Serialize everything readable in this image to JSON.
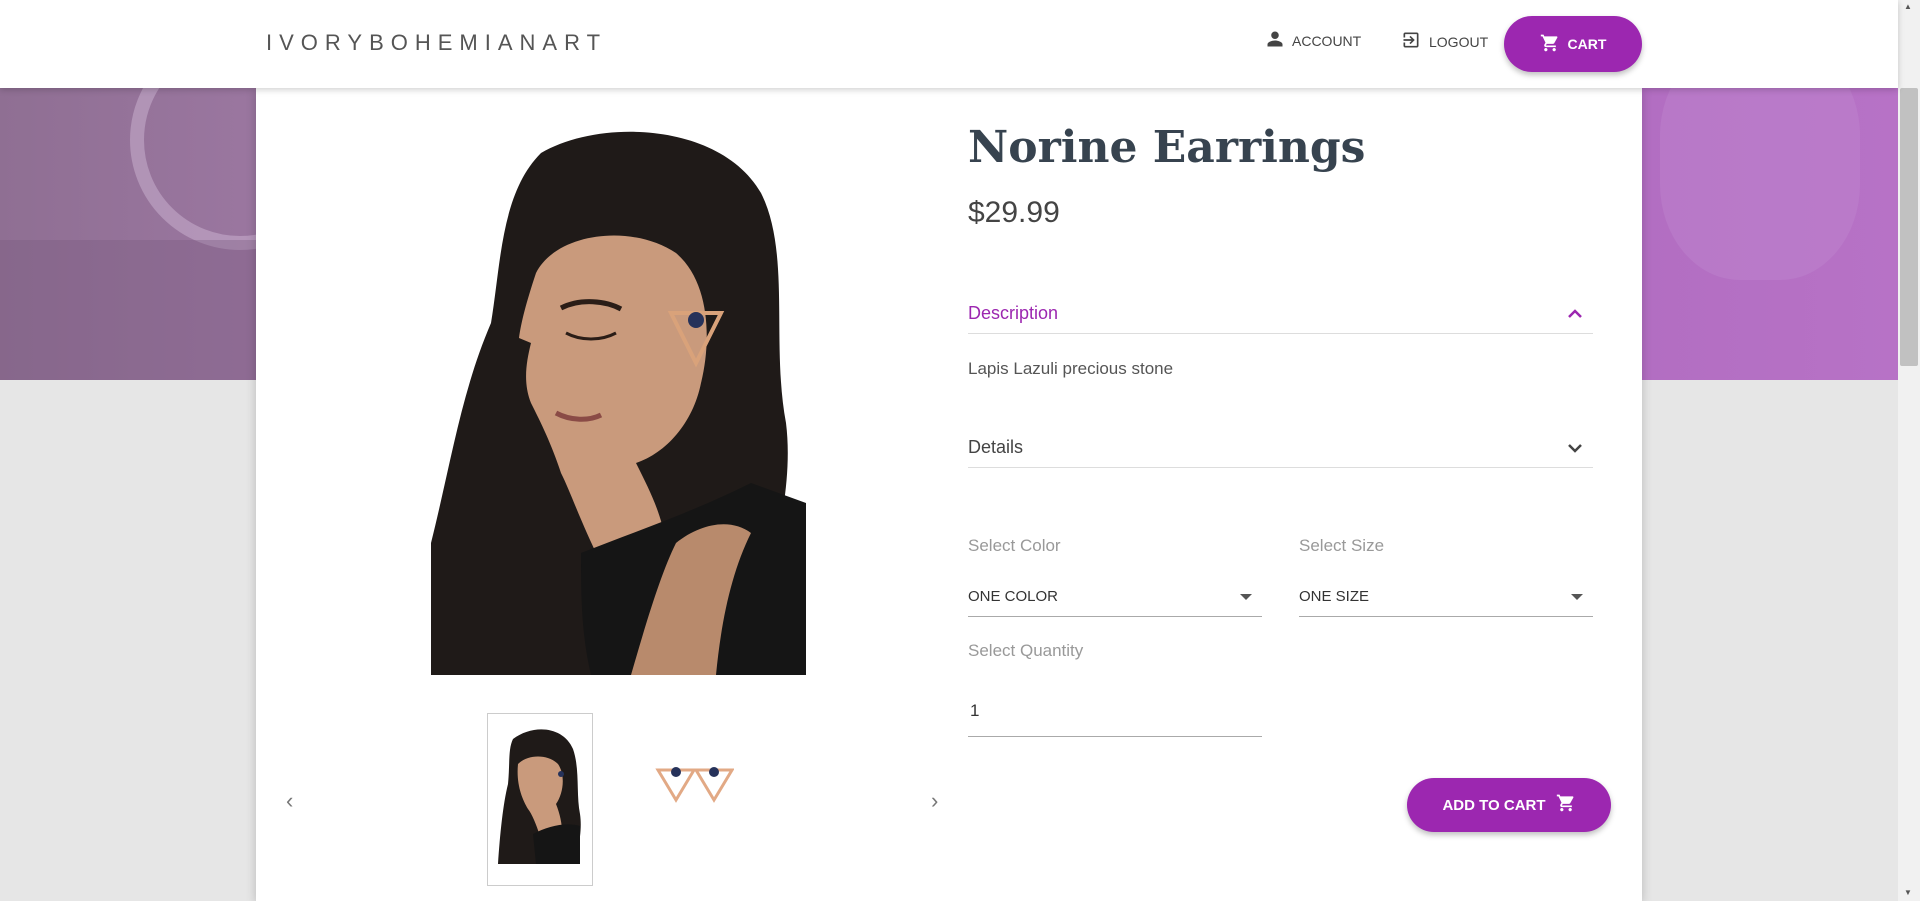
{
  "header": {
    "brand": "IVORYBOHEMIANART",
    "account_label": "ACCOUNT",
    "logout_label": "LOGOUT",
    "cart_label": "CART"
  },
  "product": {
    "name": "Norine Earrings",
    "price": "$29.99",
    "description_label": "Description",
    "description_text": "Lapis Lazuli precious stone",
    "details_label": "Details",
    "color_label": "Select Color",
    "color_value": "ONE COLOR",
    "size_label": "Select Size",
    "size_value": "ONE SIZE",
    "quantity_label": "Select Quantity",
    "quantity_value": "1",
    "add_to_cart_label": "ADD TO CART"
  },
  "colors": {
    "accent": "#9c27b0",
    "title": "#37434f"
  }
}
